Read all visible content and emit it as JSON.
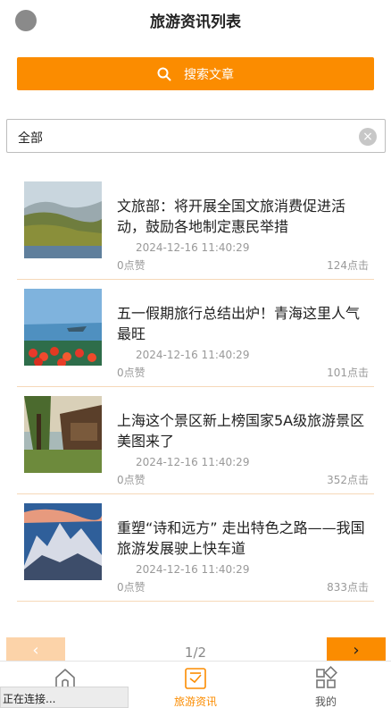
{
  "header": {
    "title": "旅游资讯列表"
  },
  "search": {
    "label": "搜索文章"
  },
  "filter": {
    "value": "全部",
    "clear": "×"
  },
  "articles": [
    {
      "title": "文旅部：将开展全国文旅消费促进活动，鼓励各地制定惠民举措",
      "date": "2024-12-16 11:40:29",
      "likes": "0点赞",
      "clicks": "124点击"
    },
    {
      "title": "五一假期旅行总结出炉！青海这里人气最旺",
      "date": "2024-12-16 11:40:29",
      "likes": "0点赞",
      "clicks": "101点击"
    },
    {
      "title": "上海这个景区新上榜国家5A级旅游景区 美图来了",
      "date": "2024-12-16 11:40:29",
      "likes": "0点赞",
      "clicks": "352点击"
    },
    {
      "title": "重塑“诗和远方” 走出特色之路——我国旅游发展驶上快车道",
      "date": "2024-12-16 11:40:29",
      "likes": "0点赞",
      "clicks": "833点击"
    }
  ],
  "pager": {
    "prev": "‹",
    "next": "›",
    "info": "1/2"
  },
  "tabbar": {
    "home": {
      "label": "",
      "icon": "home-icon"
    },
    "news": {
      "label": "旅游资讯",
      "icon": "news-icon"
    },
    "mine": {
      "label": "我的",
      "icon": "grid-icon"
    }
  },
  "status": {
    "text": "正在连接..."
  },
  "colors": {
    "accent": "#fb8c00",
    "accent_light": "#fcd3a9",
    "divider": "#f6d8b8"
  }
}
